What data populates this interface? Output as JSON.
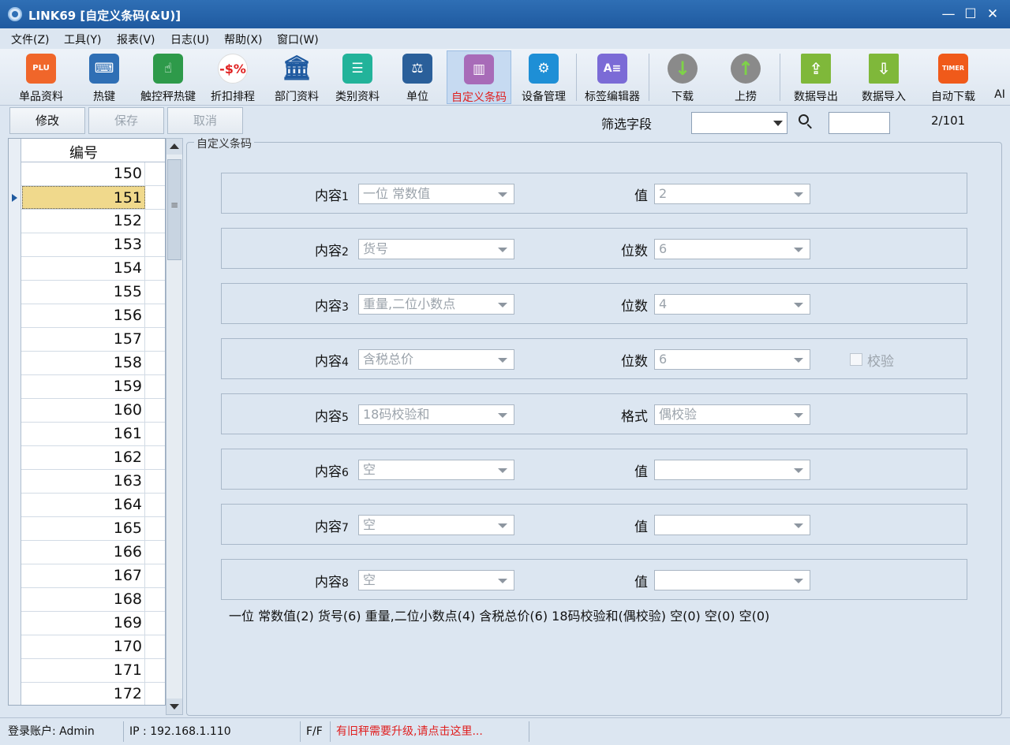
{
  "window": {
    "title": "LINK69 [自定义条码(&U)]",
    "minimize": "—",
    "maximize": "☐",
    "close": "✕"
  },
  "menu": [
    "文件(Z)",
    "工具(Y)",
    "报表(V)",
    "日志(U)",
    "帮助(X)",
    "窗口(W)"
  ],
  "toolbar": [
    {
      "label": "单品资料",
      "icon": "plu-gift-icon",
      "color": "#f0662a",
      "glyph": "PLU"
    },
    {
      "label": "热键",
      "icon": "keyboard-icon",
      "color": "#2f6fb5",
      "glyph": "⌨"
    },
    {
      "label": "触控秤热键",
      "icon": "touch-scale-icon",
      "color": "#2e9a4a",
      "glyph": "☝"
    },
    {
      "label": "折扣排程",
      "icon": "discount-icon",
      "color": "#ffffff",
      "glyph": "-$%"
    },
    {
      "label": "部门资料",
      "icon": "department-building-icon",
      "color": "#1f5aa0",
      "glyph": "🏛"
    },
    {
      "label": "类别资料",
      "icon": "category-list-icon",
      "color": "#22b39a",
      "glyph": "☰"
    },
    {
      "label": "单位",
      "icon": "unit-weight-icon",
      "color": "#2a5f9a",
      "glyph": "⚖"
    },
    {
      "label": "自定义条码",
      "icon": "barcode-icon",
      "color": "#a86bb8",
      "glyph": "▥"
    },
    {
      "label": "设备管理",
      "icon": "device-icon",
      "color": "#1e8fd6",
      "glyph": "⚙"
    },
    {
      "label": "标签编辑器",
      "icon": "label-editor-icon",
      "color": "#7b6bd6",
      "glyph": "A≡"
    },
    {
      "label": "下载",
      "icon": "download-arrow-icon",
      "color": "#5aa63c",
      "glyph": "↓"
    },
    {
      "label": "上捞",
      "icon": "upload-arrow-icon",
      "color": "#5aa63c",
      "glyph": "↑"
    },
    {
      "label": "数据导出",
      "icon": "data-export-icon",
      "color": "#7fb83a",
      "glyph": "⇪"
    },
    {
      "label": "数据导入",
      "icon": "data-import-icon",
      "color": "#7fb83a",
      "glyph": "⇩"
    },
    {
      "label": "自动下载",
      "icon": "timer-icon",
      "color": "#f05a1a",
      "glyph": "TIMER"
    },
    {
      "label": "AI",
      "icon": "",
      "color": "",
      "glyph": ""
    }
  ],
  "actions": {
    "edit": "修改",
    "save": "保存",
    "cancel": "取消"
  },
  "filter": {
    "label": "筛选字段",
    "value": "",
    "search_value": "",
    "pager": "2/101"
  },
  "grid": {
    "header": "编号",
    "rows": [
      "150",
      "151",
      "152",
      "153",
      "154",
      "155",
      "156",
      "157",
      "158",
      "159",
      "160",
      "161",
      "162",
      "163",
      "164",
      "165",
      "166",
      "167",
      "168",
      "169",
      "170",
      "171",
      "172"
    ],
    "selected": "151"
  },
  "panel": {
    "title": "自定义条码",
    "rows": [
      {
        "label": "内容",
        "num": "1",
        "value1": "一位 常数值",
        "label2": "值",
        "value2": "2"
      },
      {
        "label": "内容",
        "num": "2",
        "value1": "货号",
        "label2": "位数",
        "value2": "6"
      },
      {
        "label": "内容",
        "num": "3",
        "value1": "重量,二位小数点",
        "label2": "位数",
        "value2": "4"
      },
      {
        "label": "内容",
        "num": "4",
        "value1": "含税总价",
        "label2": "位数",
        "value2": "6",
        "checkbox": "校验"
      },
      {
        "label": "内容",
        "num": "5",
        "value1": "18码校验和",
        "label2": "格式",
        "value2": "偶校验"
      },
      {
        "label": "内容",
        "num": "6",
        "value1": "空",
        "label2": "值",
        "value2": ""
      },
      {
        "label": "内容",
        "num": "7",
        "value1": "空",
        "label2": "值",
        "value2": ""
      },
      {
        "label": "内容",
        "num": "8",
        "value1": "空",
        "label2": "值",
        "value2": ""
      }
    ],
    "summary": "一位 常数值(2)  货号(6)  重量,二位小数点(4)  含税总价(6)  18码校验和(偶校验)  空(0)  空(0)  空(0)"
  },
  "status": {
    "account": "登录账户: Admin",
    "ip": "IP : 192.168.1.110",
    "ff": "F/F",
    "message": "有旧秤需要升级,请点击这里...",
    "message_color": "#e02020"
  }
}
